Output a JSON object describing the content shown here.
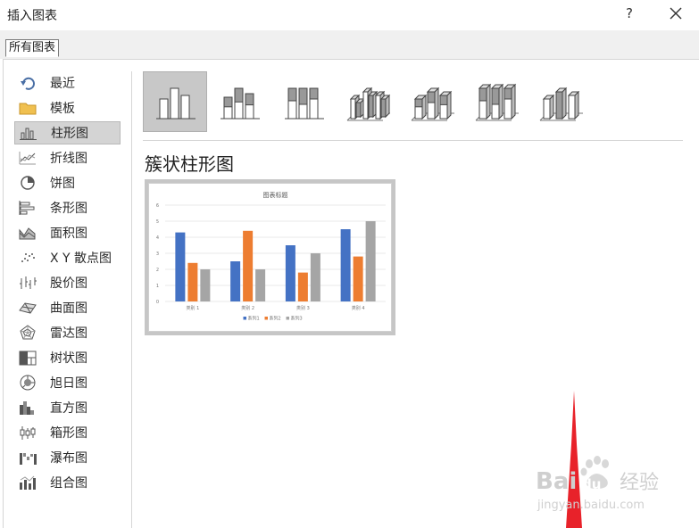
{
  "window": {
    "title": "插入图表",
    "help_label": "?"
  },
  "tabs": {
    "all_charts": "所有图表"
  },
  "sidebar": {
    "items": [
      {
        "label": "最近",
        "icon": "recent-icon"
      },
      {
        "label": "模板",
        "icon": "folder-icon"
      },
      {
        "label": "柱形图",
        "icon": "column-chart-icon",
        "selected": true
      },
      {
        "label": "折线图",
        "icon": "line-chart-icon"
      },
      {
        "label": "饼图",
        "icon": "pie-chart-icon"
      },
      {
        "label": "条形图",
        "icon": "bar-chart-icon"
      },
      {
        "label": "面积图",
        "icon": "area-chart-icon"
      },
      {
        "label": "X Y 散点图",
        "icon": "scatter-chart-icon"
      },
      {
        "label": "股价图",
        "icon": "stock-chart-icon"
      },
      {
        "label": "曲面图",
        "icon": "surface-chart-icon"
      },
      {
        "label": "雷达图",
        "icon": "radar-chart-icon"
      },
      {
        "label": "树状图",
        "icon": "treemap-chart-icon"
      },
      {
        "label": "旭日图",
        "icon": "sunburst-chart-icon"
      },
      {
        "label": "直方图",
        "icon": "histogram-chart-icon"
      },
      {
        "label": "箱形图",
        "icon": "box-whisker-chart-icon"
      },
      {
        "label": "瀑布图",
        "icon": "waterfall-chart-icon"
      },
      {
        "label": "组合图",
        "icon": "combo-chart-icon"
      }
    ]
  },
  "subtypes": [
    {
      "icon": "clustered-column-icon",
      "selected": true
    },
    {
      "icon": "stacked-column-icon"
    },
    {
      "icon": "percent-stacked-column-icon"
    },
    {
      "icon": "3d-clustered-column-icon"
    },
    {
      "icon": "3d-stacked-column-icon"
    },
    {
      "icon": "3d-percent-stacked-column-icon"
    },
    {
      "icon": "3d-column-icon"
    }
  ],
  "selected_chart_name": "簇状柱形图",
  "preview": {
    "chart_data": {
      "type": "bar",
      "title": "图表标题",
      "categories": [
        "类别 1",
        "类别 2",
        "类别 3",
        "类别 4"
      ],
      "series": [
        {
          "name": "系列1",
          "values": [
            4.3,
            2.5,
            3.5,
            4.5
          ],
          "color": "#4472c4"
        },
        {
          "name": "系列2",
          "values": [
            2.4,
            4.4,
            1.8,
            2.8
          ],
          "color": "#ed7d31"
        },
        {
          "name": "系列3",
          "values": [
            2.0,
            2.0,
            3.0,
            5.0
          ],
          "color": "#a5a5a5"
        }
      ],
      "ylim": [
        0,
        6
      ],
      "yticks": [
        "0",
        "1",
        "2",
        "3",
        "4",
        "5",
        "6"
      ],
      "grid": true,
      "legend": "bottom"
    }
  },
  "watermark": {
    "brand": "Bai",
    "brand2": "du",
    "suffix": "经验",
    "url": "jingyan.baidu.com"
  },
  "colors": {
    "accent_red": "#e8222a",
    "selected_bg": "#d4d4d4"
  }
}
